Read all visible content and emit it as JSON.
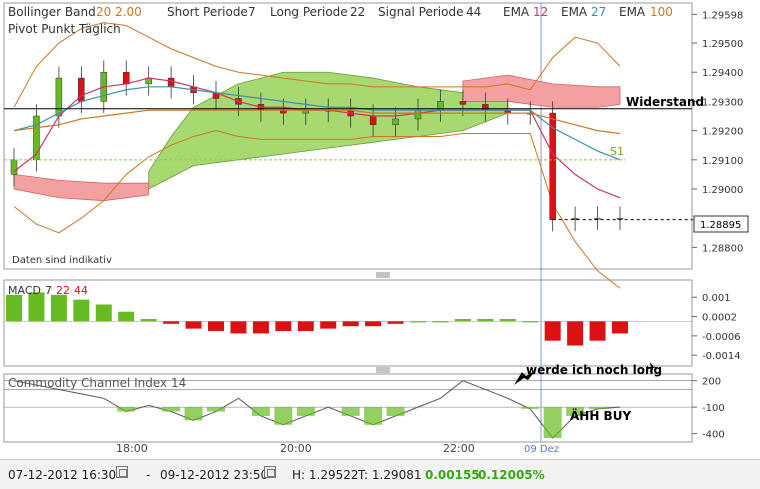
{
  "header": {
    "bollinger_label": "Bollinger Band",
    "bollinger_value": "20 2.00",
    "short_label": "Short Periode",
    "short_value": "7",
    "long_label": "Long Periode",
    "long_value": "22",
    "signal_label": "Signal Periode",
    "signal_value": "44",
    "ema1_label": "EMA",
    "ema1_value": "12",
    "ema2_label": "EMA",
    "ema2_value": "27",
    "ema3_label": "EMA",
    "ema3_value": "100",
    "pivot_label": "Pivot Punkt Täglich"
  },
  "notes": {
    "indicative": "Daten sind indikativ",
    "resistance": "Widerstand",
    "s1": "S1",
    "long_note": "werde ich noch long",
    "buy_note": "ÄHH BUY"
  },
  "current_price": "1.28895",
  "macd_title": {
    "name": "MACD",
    "p1": "7",
    "p2": "22",
    "p3": "44"
  },
  "cci_title": "Commodity Channel Index 14",
  "x_axis": {
    "ticks": [
      "18:00",
      "20:00",
      "22:00"
    ],
    "date_marker": "09 Dez"
  },
  "footer": {
    "from": "07-12-2012 16:30",
    "dash": "-",
    "to": "09-12-2012 23:50",
    "high_label": "H: 1.29522",
    "low_label": "T: 1.29081",
    "change": "0.00155",
    "change_pct": "0.12005%"
  },
  "colors": {
    "up": "#66bb22",
    "down": "#dd1111",
    "ema12": "#cc3366",
    "ema27": "#3a8fb0",
    "ema100": "#cc7722",
    "cloud_green": "#a8d870",
    "cloud_red": "#f4a0a0",
    "bollinger": "#cc7722",
    "resistance_line": "#000000",
    "s1_line": "#88cc44"
  },
  "chart_data": [
    {
      "type": "line",
      "title": "Price (candlestick) with Bollinger Band 20 2.00, EMA 12/27/100, Ichimoku cloud, Pivot",
      "y_ticks": [
        "1.29598",
        "1.29500",
        "1.29400",
        "1.29300",
        "1.29200",
        "1.29100",
        "1.29000",
        "1.28895",
        "1.28800"
      ],
      "ylim": [
        1.2875,
        1.2962
      ],
      "x": [
        "17:00",
        "17:15",
        "17:30",
        "17:45",
        "18:00",
        "18:15",
        "18:30",
        "18:45",
        "19:00",
        "19:15",
        "19:30",
        "19:45",
        "20:00",
        "20:15",
        "20:30",
        "20:45",
        "21:00",
        "21:15",
        "21:30",
        "21:45",
        "22:00",
        "22:15",
        "22:30",
        "22:45",
        "23:00",
        "23:15",
        "23:30",
        "23:45"
      ],
      "series": [
        {
          "name": "EMA 12",
          "values": [
            1.2906,
            1.2912,
            1.2925,
            1.2932,
            1.2935,
            1.2936,
            1.2938,
            1.2937,
            1.2935,
            1.2933,
            1.293,
            1.2928,
            1.2928,
            1.2927,
            1.2927,
            1.2926,
            1.2925,
            1.2925,
            1.2926,
            1.2927,
            1.2927,
            1.2927,
            1.2927,
            1.2927,
            1.2912,
            1.2905,
            1.29,
            1.2897
          ]
        },
        {
          "name": "EMA 27",
          "values": [
            1.292,
            1.2922,
            1.2926,
            1.293,
            1.2932,
            1.2934,
            1.2935,
            1.2935,
            1.2934,
            1.2933,
            1.2932,
            1.2931,
            1.293,
            1.2929,
            1.2928,
            1.2928,
            1.2927,
            1.2927,
            1.2927,
            1.2927,
            1.2927,
            1.2927,
            1.2927,
            1.2927,
            1.2921,
            1.2917,
            1.2913,
            1.291
          ]
        },
        {
          "name": "EMA 100",
          "values": [
            1.292,
            1.2921,
            1.2922,
            1.2924,
            1.2925,
            1.2926,
            1.2927,
            1.2927,
            1.2927,
            1.2927,
            1.2927,
            1.2927,
            1.2927,
            1.2927,
            1.2927,
            1.2927,
            1.2926,
            1.2926,
            1.2926,
            1.2926,
            1.2926,
            1.2926,
            1.2926,
            1.2926,
            1.2924,
            1.2922,
            1.292,
            1.2919
          ]
        }
      ],
      "last_price": 1.28895
    },
    {
      "type": "bar",
      "title": "MACD 7 22 44",
      "y_ticks": [
        "0.001",
        "0.0002",
        "-0.0006",
        "-0.0014"
      ],
      "values": [
        0.0011,
        0.0012,
        0.0011,
        0.0009,
        0.0007,
        0.0004,
        0.0001,
        -0.0001,
        -0.0003,
        -0.0004,
        -0.0005,
        -0.0005,
        -0.0004,
        -0.0004,
        -0.0003,
        -0.0002,
        -0.0002,
        -0.0001,
        0.0,
        0.0,
        0.0001,
        0.0001,
        0.0001,
        0.0,
        -0.0008,
        -0.001,
        -0.0008,
        -0.0005
      ]
    },
    {
      "type": "area",
      "title": "Commodity Channel Index 14",
      "y_ticks": [
        "200",
        "-100",
        "-400"
      ],
      "values": [
        200,
        150,
        100,
        50,
        0,
        -150,
        -80,
        -150,
        -250,
        -150,
        0,
        -200,
        -300,
        -200,
        -100,
        -200,
        -300,
        -200,
        -100,
        0,
        200,
        100,
        0,
        -120,
        -450,
        -200,
        -120,
        -100
      ]
    }
  ]
}
